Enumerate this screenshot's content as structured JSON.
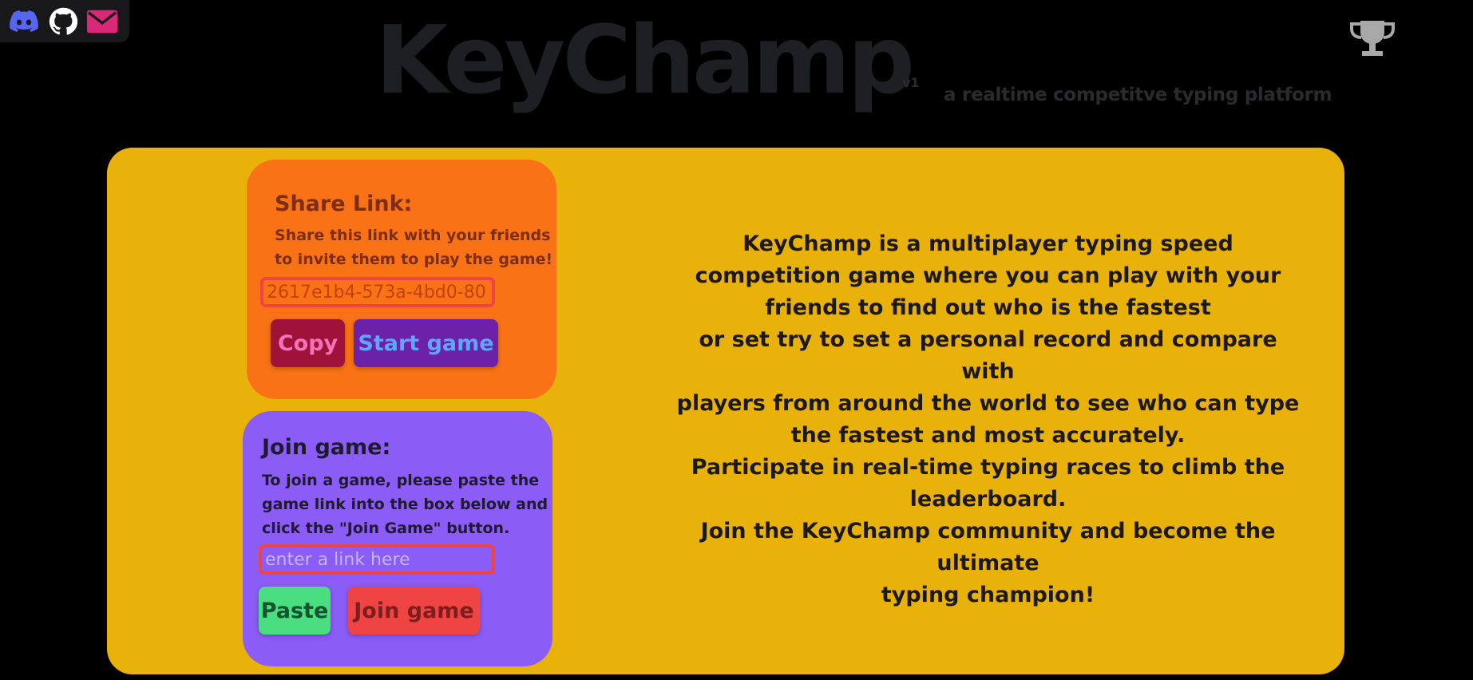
{
  "header": {
    "brand": "KeyChamp",
    "version": "v1",
    "tagline": "a realtime competitve typing platform"
  },
  "social": {
    "icons": [
      "discord-icon",
      "github-icon",
      "mail-icon"
    ],
    "colors": {
      "discord": "#5865f2",
      "github": "#ffffff",
      "mail": "#db2777"
    }
  },
  "trophy": {
    "icon": "trophy-icon",
    "color": "#a8a8a8"
  },
  "share": {
    "title": "Share Link:",
    "description_lines": [
      "Share this link with your friends",
      "to invite them to play the game!"
    ],
    "link_value": "2617e1b4-573a-4bd0-80 …",
    "copy_label": "Copy",
    "start_label": "Start game"
  },
  "join": {
    "title": "Join game:",
    "description_lines": [
      "To join a game, please paste the",
      "game link into the box below and",
      "click the \"Join Game\" button."
    ],
    "placeholder": "enter a link here",
    "paste_label": "Paste",
    "join_label": "Join game"
  },
  "about": {
    "lines": [
      "KeyChamp is a multiplayer typing speed",
      "competition game where you can play with your",
      "friends to find out who is the fastest",
      "or set try to set a personal record and compare with",
      "players from around the world to see who can type",
      "the fastest and most accurately.",
      "Participate in real-time typing races to climb the",
      "leaderboard.",
      "Join the KeyChamp community and become the",
      "ultimate",
      "typing champion!"
    ]
  },
  "colors": {
    "background": "#000000",
    "panel": "#e9b20b",
    "share_card": "#f97316",
    "join_card": "#8b5cf6",
    "copy_button": "#9f1239",
    "start_button": "#6b21a8",
    "paste_button": "#4ade80",
    "join_button": "#ef4444",
    "field_border": "#ef4444"
  }
}
